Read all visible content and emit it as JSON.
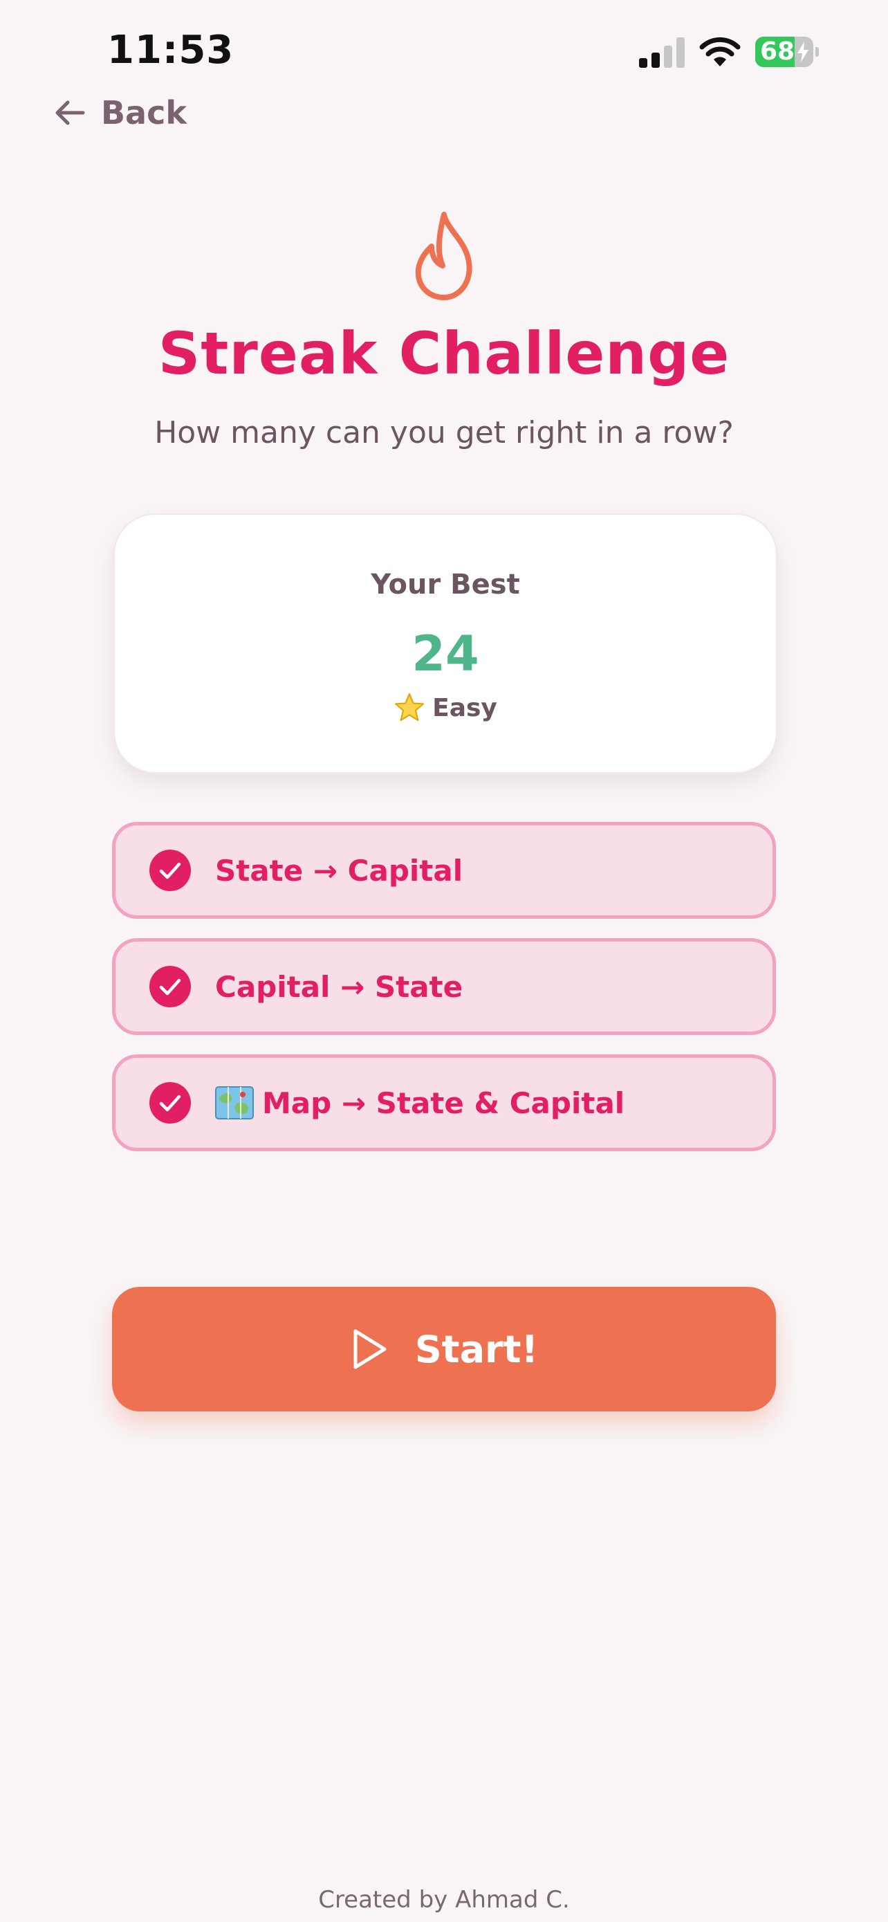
{
  "status_bar": {
    "time": "11:53",
    "battery_percent": "68",
    "battery_level": 0.68,
    "icons": [
      "signal-icon",
      "wifi-icon",
      "battery-charging-icon"
    ]
  },
  "nav": {
    "back_label": "Back",
    "back_icon": "arrow-left-icon"
  },
  "header": {
    "icon": "flame-icon",
    "title": "Streak Challenge",
    "subtitle": "How many can you get right in a row?"
  },
  "best_card": {
    "label": "Your Best",
    "score": "24",
    "difficulty": "Easy",
    "difficulty_icon": "star-icon"
  },
  "modes": [
    {
      "label": "State → Capital",
      "selected": true
    },
    {
      "label": "Capital → State",
      "selected": true
    },
    {
      "label": "Map → State & Capital",
      "selected": true,
      "icon": "map-icon"
    }
  ],
  "start_button": {
    "label": "Start!",
    "icon": "play-icon"
  },
  "footer": {
    "credit": "Created by Ahmad C."
  },
  "colors": {
    "background": "#f9f5f6",
    "accent_pink": "#e21f63",
    "option_bg": "#f8dfe7",
    "option_border": "#f3a2bf",
    "score_green": "#4fb68c",
    "start_orange": "#ee7251",
    "flame_orange": "#ee7251"
  }
}
